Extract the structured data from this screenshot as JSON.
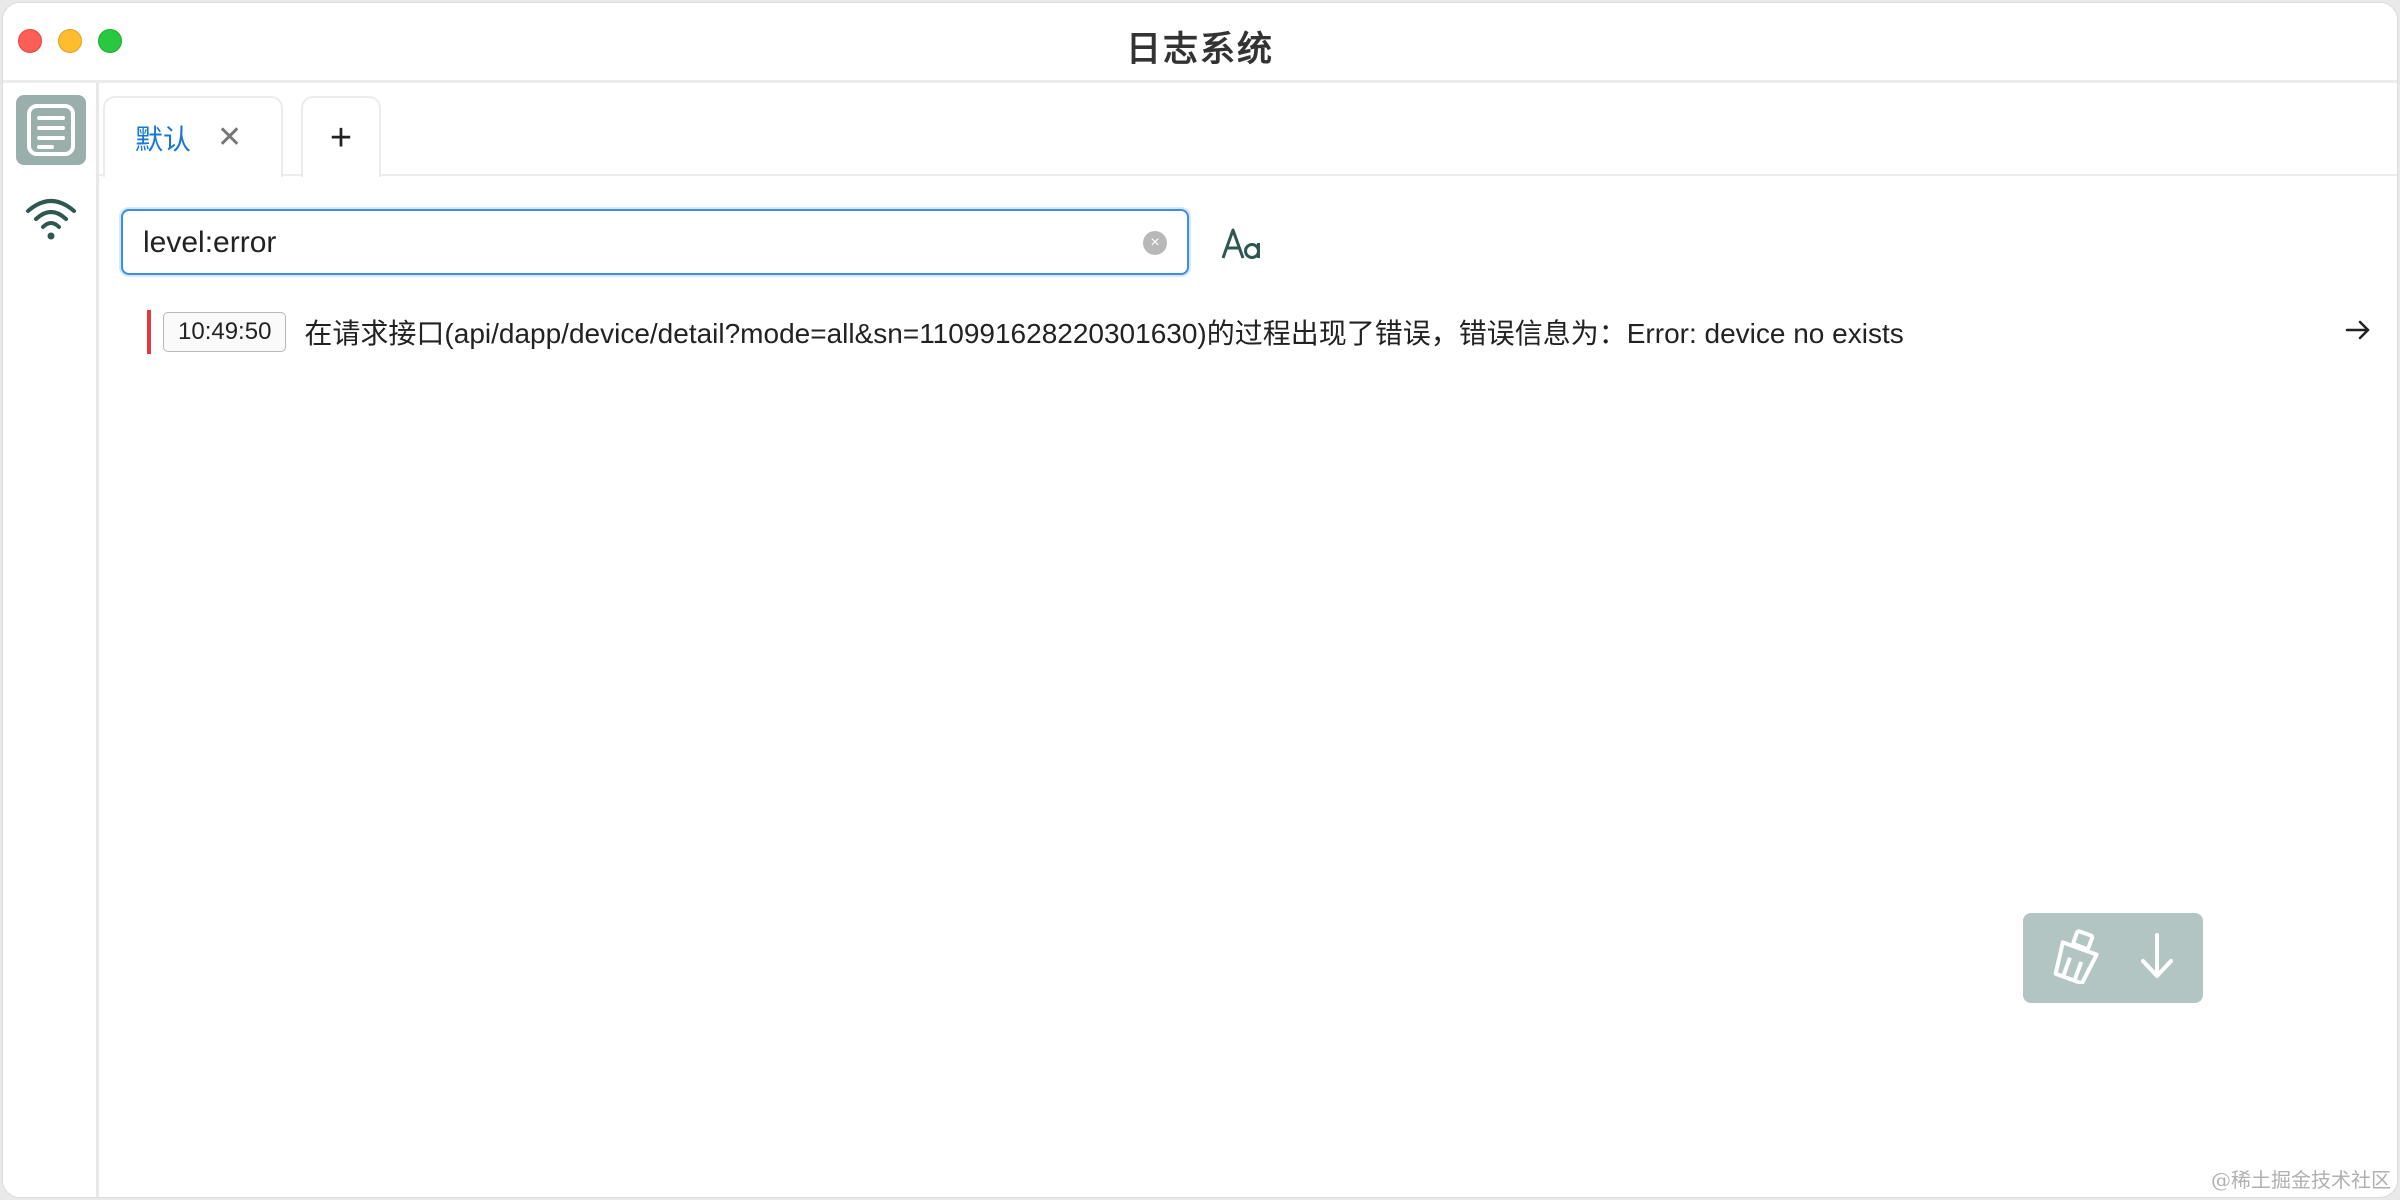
{
  "window": {
    "title": "日志系统"
  },
  "sidebar": {
    "items": [
      {
        "icon": "log-document-icon",
        "active": true
      },
      {
        "icon": "wifi-icon",
        "active": false
      }
    ]
  },
  "tabs": [
    {
      "label": "默认",
      "close_glyph": "✕"
    }
  ],
  "add_tab_glyph": "+",
  "search": {
    "value": "level:error",
    "clear_glyph": "×"
  },
  "case_toggle_icon": "case-sensitive-icon",
  "logs": [
    {
      "level": "error",
      "time": "10:49:50",
      "message": "在请求接口(api/dapp/device/detail?mode=all&sn=110991628220301630)的过程出现了错误，错误信息为：Error: device no exists"
    }
  ],
  "floating_actions": [
    {
      "icon": "clear-brush-icon"
    },
    {
      "icon": "scroll-down-icon"
    }
  ],
  "colors": {
    "accent": "#1677d6",
    "error": "#e4393c",
    "sidebar_active": "#9aafab",
    "floating_panel": "#b3c5c2"
  },
  "watermark": "@稀土掘金技术社区"
}
